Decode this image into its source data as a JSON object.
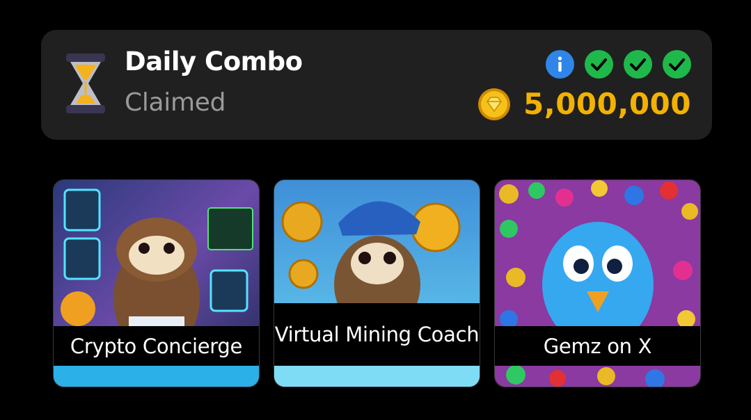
{
  "combo": {
    "title": "Daily Combo",
    "status": "Claimed",
    "reward_amount": "5,000,000",
    "icons": [
      "hourglass-icon",
      "info-icon",
      "check-icon",
      "check-icon",
      "check-icon",
      "coin-icon"
    ],
    "colors": {
      "info": "#2f86e8",
      "check": "#1fb84a",
      "reward": "#f3b200",
      "status": "#9a9a9a"
    }
  },
  "cards": [
    {
      "title": "Crypto Concierge"
    },
    {
      "title": "Virtual Mining Coach"
    },
    {
      "title": "Gemz on X"
    }
  ]
}
